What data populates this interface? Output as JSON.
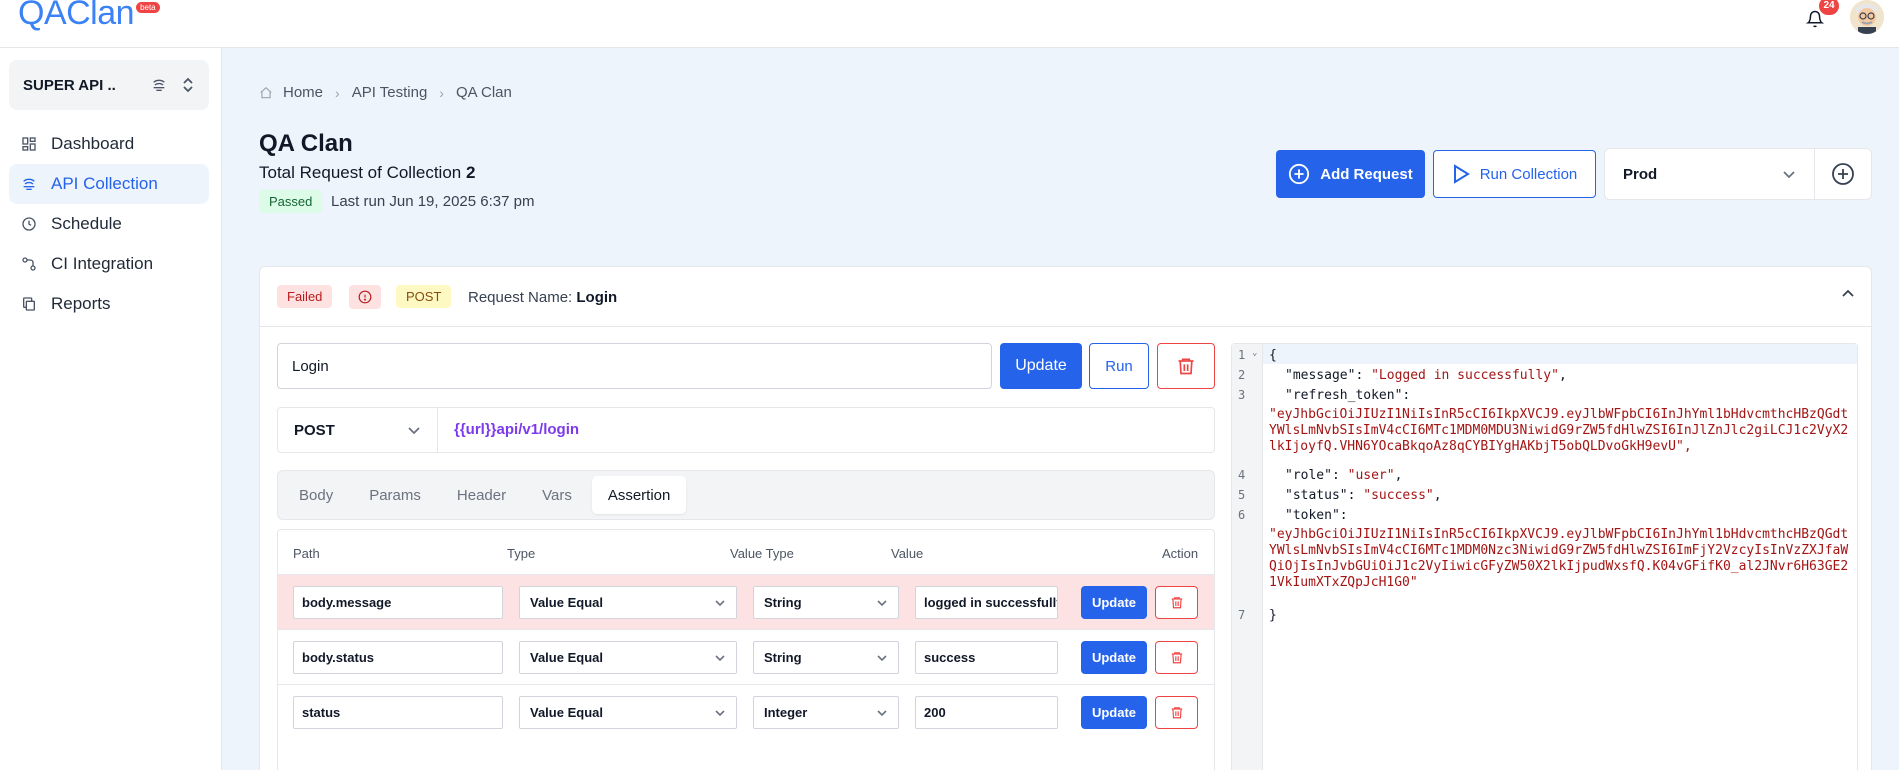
{
  "app": {
    "logo": "QAClan",
    "logo_badge": "beta",
    "notifications": "24"
  },
  "sidebar": {
    "workspace": "SUPER API ..",
    "items": [
      {
        "label": "Dashboard",
        "icon": "grid-icon"
      },
      {
        "label": "API Collection",
        "icon": "api-icon"
      },
      {
        "label": "Schedule",
        "icon": "clock-icon"
      },
      {
        "label": "CI Integration",
        "icon": "integration-icon"
      },
      {
        "label": "Reports",
        "icon": "copy-icon"
      }
    ]
  },
  "breadcrumb": [
    "Home",
    "API Testing",
    "QA Clan"
  ],
  "collection": {
    "title": "QA Clan",
    "total_label": "Total Request of Collection",
    "total_count": "2",
    "status": "Passed",
    "last_run": "Last run Jun 19, 2025 6:37 pm"
  },
  "actions": {
    "add_request": "Add Request",
    "run_collection": "Run Collection",
    "environment": "Prod"
  },
  "request": {
    "status": "Failed",
    "method_badge": "POST",
    "name_label": "Request Name:",
    "name": "Login",
    "name_input": "Login",
    "update": "Update",
    "run": "Run",
    "method": "POST",
    "url_var": "{{url}}",
    "url_path": "api/v1/login",
    "tabs": [
      "Body",
      "Params",
      "Header",
      "Vars",
      "Assertion"
    ],
    "active_tab": "Assertion"
  },
  "assertions": {
    "headers": [
      "Path",
      "Type",
      "Value Type",
      "Value",
      "Action"
    ],
    "update_label": "Update",
    "rows": [
      {
        "path": "body.message",
        "type": "Value Equal",
        "value_type": "String",
        "value": "logged in successfully",
        "failed": true
      },
      {
        "path": "body.status",
        "type": "Value Equal",
        "value_type": "String",
        "value": "success",
        "failed": false
      },
      {
        "path": "status",
        "type": "Value Equal",
        "value_type": "Integer",
        "value": "200",
        "failed": false
      }
    ]
  },
  "response": {
    "line_numbers": [
      "1",
      "2",
      "3",
      "4",
      "5",
      "6",
      "7"
    ],
    "open_brace": "{",
    "close_brace": "}",
    "message_key": "\"message\": ",
    "message_val": "\"Logged in successfully\"",
    "refresh_key": "\"refresh_token\":",
    "refresh_val": "\"eyJhbGciOiJIUzI1NiIsInR5cCI6IkpXVCJ9.eyJlbWFpbCI6InJhYml1bHdvcmthcHBzQGdtYWlsLmNvbSIsImV4cCI6MTc1MDM0MDU3NiwidG9rZW5fdHlwZSI6InJlZnJlc2giLCJ1c2VyX2lkIjoyfQ.VHN6YOcaBkqoAz8qCYBIYgHAKbjT5obQLDvoGkH9evU\",",
    "role_key": "\"role\": ",
    "role_val": "\"user\"",
    "status_key": "\"status\": ",
    "status_val": "\"success\"",
    "token_key": "\"token\":",
    "token_val": "\"eyJhbGciOiJIUzI1NiIsInR5cCI6IkpXVCJ9.eyJlbWFpbCI6InJhYml1bHdvcmthcHBzQGdtYWlsLmNvbSIsImV4cCI6MTc1MDM0Nzc3NiwidG9rZW5fdHlwZSI6ImFjY2VzcyIsInVzZXJfaWQiOjIsInJvbGUiOiJ1c2VyIiwicGFyZW50X2lkIjpudWxsfQ.K04vGFifK0_al2JNvr6H63GE21VkIumXTxZQpJcH1G0\"",
    "comma": ","
  }
}
